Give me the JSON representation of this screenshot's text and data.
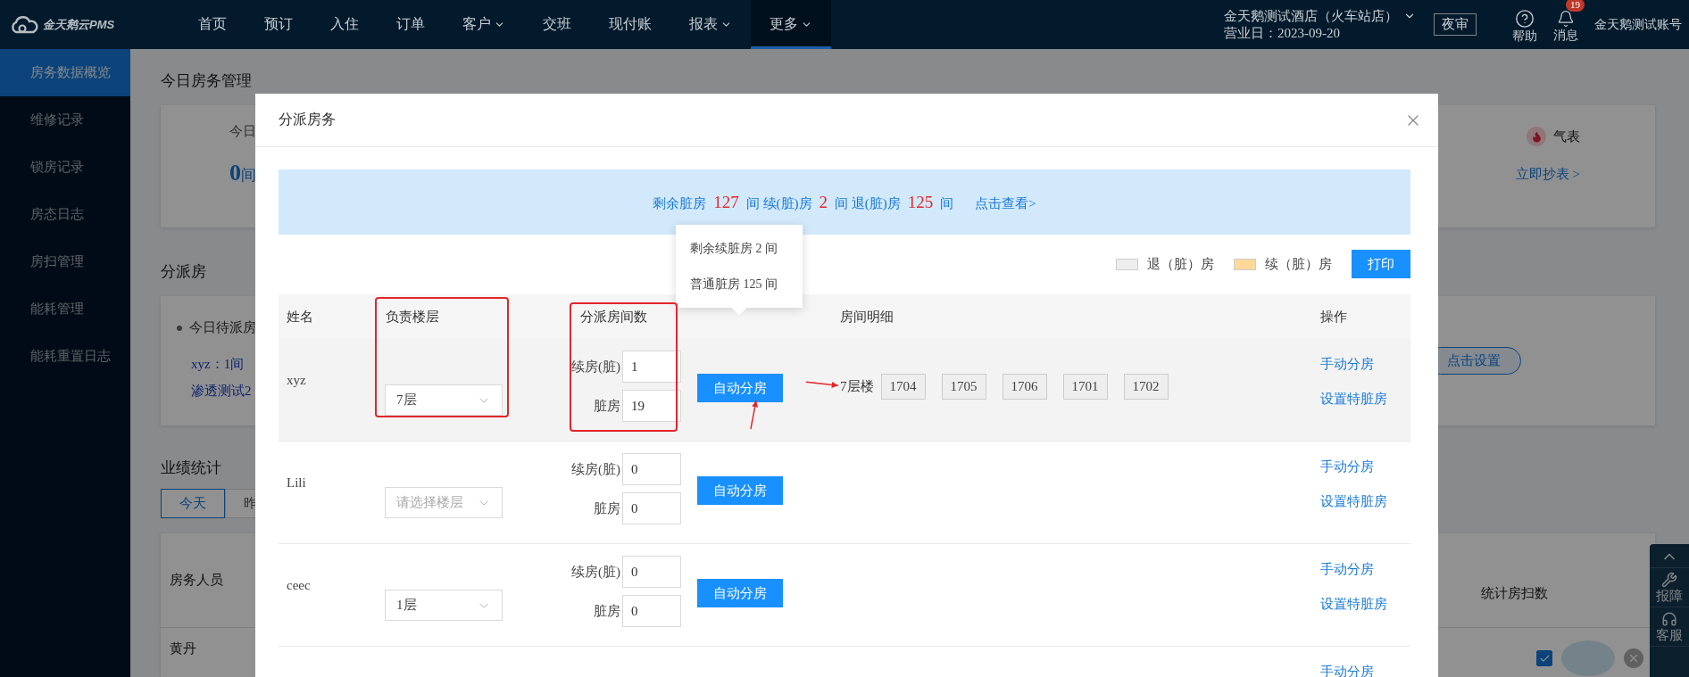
{
  "top_bar": {
    "logo": "金天鹅云PMS",
    "nav": [
      {
        "label": "首页",
        "selected": false,
        "dropdown": false
      },
      {
        "label": "预订",
        "selected": false,
        "dropdown": false
      },
      {
        "label": "入住",
        "selected": false,
        "dropdown": false
      },
      {
        "label": "订单",
        "selected": false,
        "dropdown": false
      },
      {
        "label": "客户",
        "selected": false,
        "dropdown": true
      },
      {
        "label": "交班",
        "selected": false,
        "dropdown": false
      },
      {
        "label": "现付账",
        "selected": false,
        "dropdown": false
      },
      {
        "label": "报表",
        "selected": false,
        "dropdown": true
      },
      {
        "label": "更多",
        "selected": true,
        "dropdown": true
      }
    ],
    "hotel": "金天鹅测试酒店（火车站店）",
    "business_day": "营业日：2023-09-20",
    "night_audit": "夜审",
    "help": "帮助",
    "messages": {
      "label": "消息",
      "badge": "19"
    },
    "account": "金天鹅测试账号"
  },
  "sidebar": {
    "items": [
      {
        "label": "房务数据概览",
        "selected": true
      },
      {
        "label": "维修记录",
        "selected": false
      },
      {
        "label": "锁房记录",
        "selected": false
      },
      {
        "label": "房态日志",
        "selected": false
      },
      {
        "label": "房扫管理",
        "selected": false
      },
      {
        "label": "能耗管理",
        "selected": false
      },
      {
        "label": "能耗重置日志",
        "selected": false
      }
    ]
  },
  "page": {
    "housekeeping": {
      "title": "今日房务管理",
      "stat_label": "今日",
      "stat_value": "0",
      "stat_unit": "间",
      "meter_label": "气表",
      "meter_link": "立即抄表 >"
    },
    "assign": {
      "title": "分派房",
      "bullet": "今日待派房",
      "staff": [
        "xyz：1间",
        "渗透测试2"
      ],
      "setup_button": "点击设置"
    },
    "performance": {
      "title": "业绩统计",
      "tabs": [
        {
          "label": "今天",
          "selected": true
        },
        {
          "label": "昨",
          "selected": false
        }
      ],
      "columns": [
        "房务人员",
        "统计房扫数"
      ],
      "rows": [
        {
          "name": "黄丹",
          "checked": true
        }
      ]
    }
  },
  "floating_toolbar": {
    "items": [
      {
        "kind": "up"
      },
      {
        "kind": "report",
        "label": "报障"
      },
      {
        "kind": "service",
        "label": "客服"
      }
    ]
  },
  "modal": {
    "title": "分派房务",
    "summary": [
      {
        "kind": "label",
        "text": "剩余脏房"
      },
      {
        "kind": "number",
        "text": "127"
      },
      {
        "kind": "label",
        "text": "间 续(脏)房"
      },
      {
        "kind": "number",
        "text": "2"
      },
      {
        "kind": "label",
        "text": "间 退(脏)房"
      },
      {
        "kind": "number",
        "text": "125"
      },
      {
        "kind": "label",
        "text": "间"
      },
      {
        "kind": "link",
        "text": "点击查看>"
      }
    ],
    "legend": [
      {
        "label": "退（脏）房",
        "color": "#eeeeee"
      },
      {
        "label": "续（脏）房",
        "color": "#fdd99a"
      }
    ],
    "print_button": "打印",
    "columns": [
      "姓名",
      "负责楼层",
      "分派房间数",
      "房间明细",
      "操作"
    ],
    "rows": [
      {
        "name": "xyz",
        "hovered": true,
        "floor": {
          "value": "7层"
        },
        "counts": [
          {
            "label": "续房(脏)",
            "value": "1"
          },
          {
            "label": "脏房",
            "value": "19"
          }
        ],
        "auto_button": "自动分房",
        "rooms": {
          "floor": "7层楼",
          "items": [
            "1704",
            "1705",
            "1706",
            "1701",
            "1702"
          ]
        },
        "actions": [
          "手动分房",
          "设置特脏房"
        ]
      },
      {
        "name": "Lili",
        "hovered": false,
        "floor": {
          "placeholder": "请选择楼层"
        },
        "counts": [
          {
            "label": "续房(脏)",
            "value": "0"
          },
          {
            "label": "脏房",
            "value": "0"
          }
        ],
        "auto_button": "自动分房",
        "actions": [
          "手动分房",
          "设置特脏房"
        ]
      },
      {
        "name": "ceec",
        "hovered": false,
        "floor": {
          "value": "1层"
        },
        "counts": [
          {
            "label": "续房(脏)",
            "value": "0"
          },
          {
            "label": "脏房",
            "value": "0"
          }
        ],
        "auto_button": "自动分房",
        "actions": [
          "手动分房",
          "设置特脏房"
        ]
      },
      {
        "hovered": false,
        "actions": [
          "手动分房"
        ]
      }
    ],
    "tooltip": {
      "lines": [
        "剩余续脏房 2 间",
        "普通脏房 125 间"
      ]
    }
  }
}
